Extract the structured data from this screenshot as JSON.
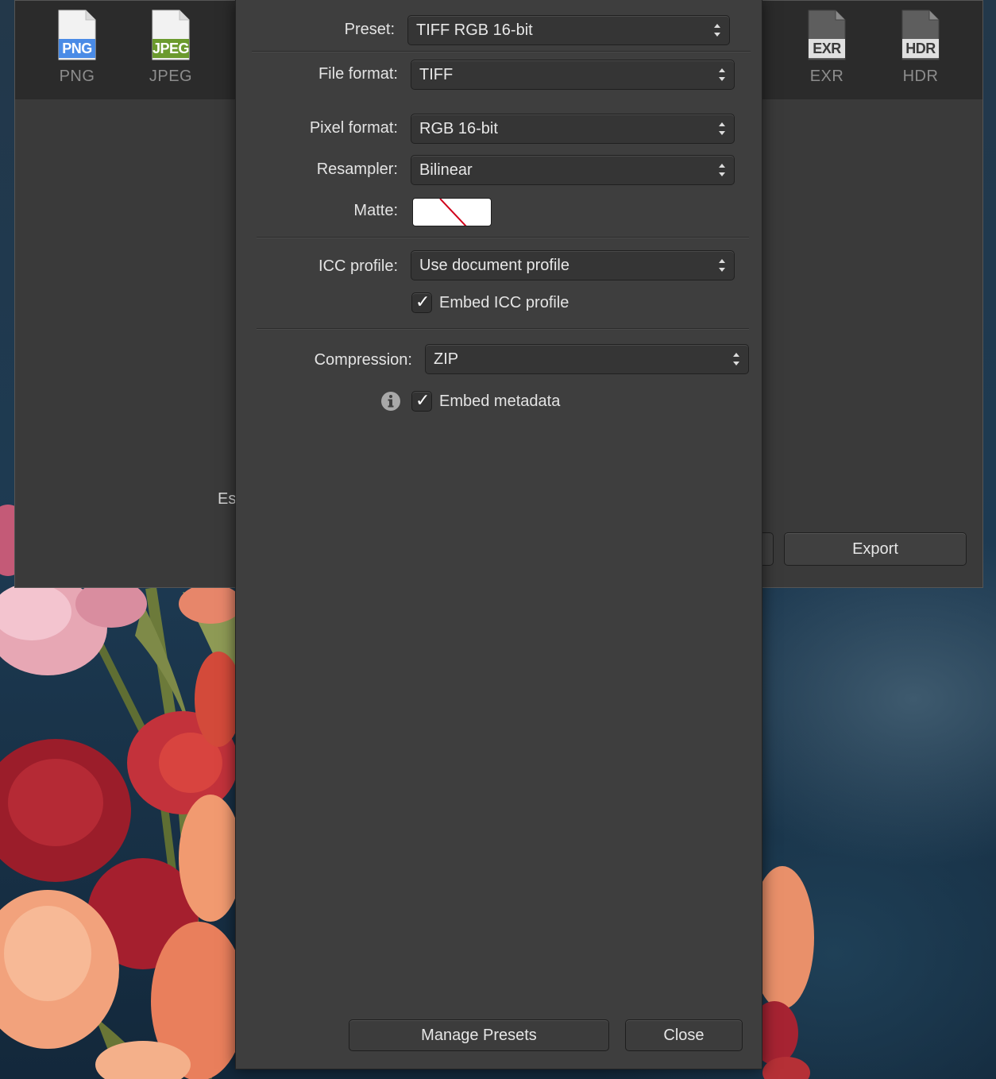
{
  "export_window": {
    "formats": [
      {
        "badge": "PNG",
        "name": "PNG",
        "color": "#4a8be6"
      },
      {
        "badge": "JPEG",
        "name": "JPEG",
        "color": "#6b9a2e"
      },
      {
        "badge": "EXR",
        "name": "EXR",
        "color": "#555555"
      },
      {
        "badge": "HDR",
        "name": "HDR",
        "color": "#555555"
      }
    ],
    "partial_text": "Es",
    "export_label": "Export"
  },
  "settings": {
    "preset": {
      "label": "Preset:",
      "value": "TIFF RGB 16-bit"
    },
    "file_format": {
      "label": "File format:",
      "value": "TIFF"
    },
    "pixel_format": {
      "label": "Pixel format:",
      "value": "RGB 16-bit"
    },
    "resampler": {
      "label": "Resampler:",
      "value": "Bilinear"
    },
    "matte": {
      "label": "Matte:"
    },
    "icc_profile": {
      "label": "ICC profile:",
      "value": "Use document profile"
    },
    "embed_icc": {
      "label": "Embed ICC profile",
      "checked": true
    },
    "compression": {
      "label": "Compression:",
      "value": "ZIP"
    },
    "embed_metadata": {
      "label": "Embed metadata",
      "checked": true
    },
    "manage_presets_label": "Manage Presets",
    "close_label": "Close"
  },
  "colors": {
    "panel_bg": "#3e3e3e",
    "matte_slash": "#d0021b"
  }
}
